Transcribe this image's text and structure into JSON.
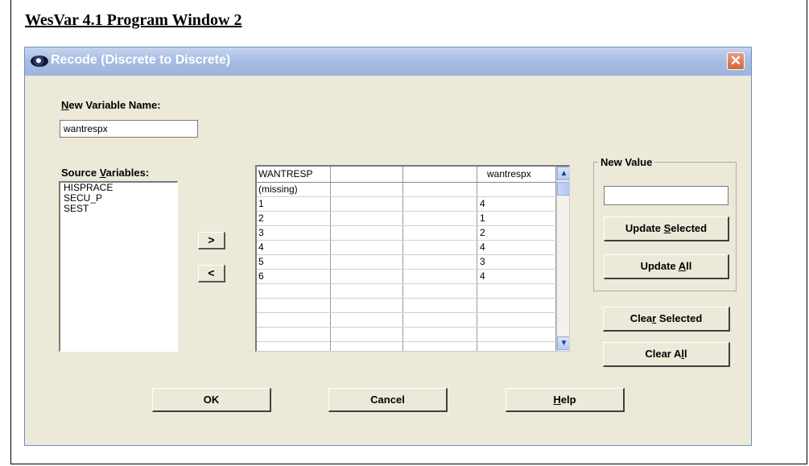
{
  "document": {
    "title": "WesVar 4.1 Program Window 2"
  },
  "window": {
    "title": "Recode (Discrete to Discrete)",
    "close_glyph": "✕"
  },
  "new_var": {
    "label_pre": "",
    "label_key": "N",
    "label_post": "ew Variable Name:",
    "value": "wantrespx"
  },
  "source": {
    "label_pre": "Source ",
    "label_key": "V",
    "label_post": "ariables:",
    "items": [
      "HISPRACE",
      "SECU_P",
      "SEST"
    ]
  },
  "move": {
    "right": ">",
    "left": "<"
  },
  "grid": {
    "headers": [
      "WANTRESP",
      "",
      "",
      "wantrespx"
    ],
    "rows": [
      [
        "(missing)",
        "",
        "",
        ""
      ],
      [
        "1",
        "",
        "",
        "4"
      ],
      [
        "2",
        "",
        "",
        "1"
      ],
      [
        "3",
        "",
        "",
        "2"
      ],
      [
        "4",
        "",
        "",
        "4"
      ],
      [
        "5",
        "",
        "",
        "3"
      ],
      [
        "6",
        "",
        "",
        "4"
      ],
      [
        "",
        "",
        "",
        ""
      ],
      [
        "",
        "",
        "",
        ""
      ],
      [
        "",
        "",
        "",
        ""
      ]
    ]
  },
  "new_value": {
    "group_label": "New Value",
    "value": ""
  },
  "buttons": {
    "update_selected": {
      "pre": "Update ",
      "key": "S",
      "post": "elected"
    },
    "update_all": {
      "pre": "Update ",
      "key": "A",
      "post": "ll"
    },
    "clear_selected": {
      "pre": "Clea",
      "key": "r",
      "post": " Selected"
    },
    "clear_all": {
      "pre": "Clear A",
      "key": "l",
      "post": "l"
    },
    "ok": "OK",
    "cancel": "Cancel",
    "help": {
      "pre": "",
      "key": "H",
      "post": "elp"
    }
  },
  "colors": {
    "titlebar": "#a8bde4",
    "dialog_bg": "#ece9d8",
    "close": "#d4663e"
  }
}
